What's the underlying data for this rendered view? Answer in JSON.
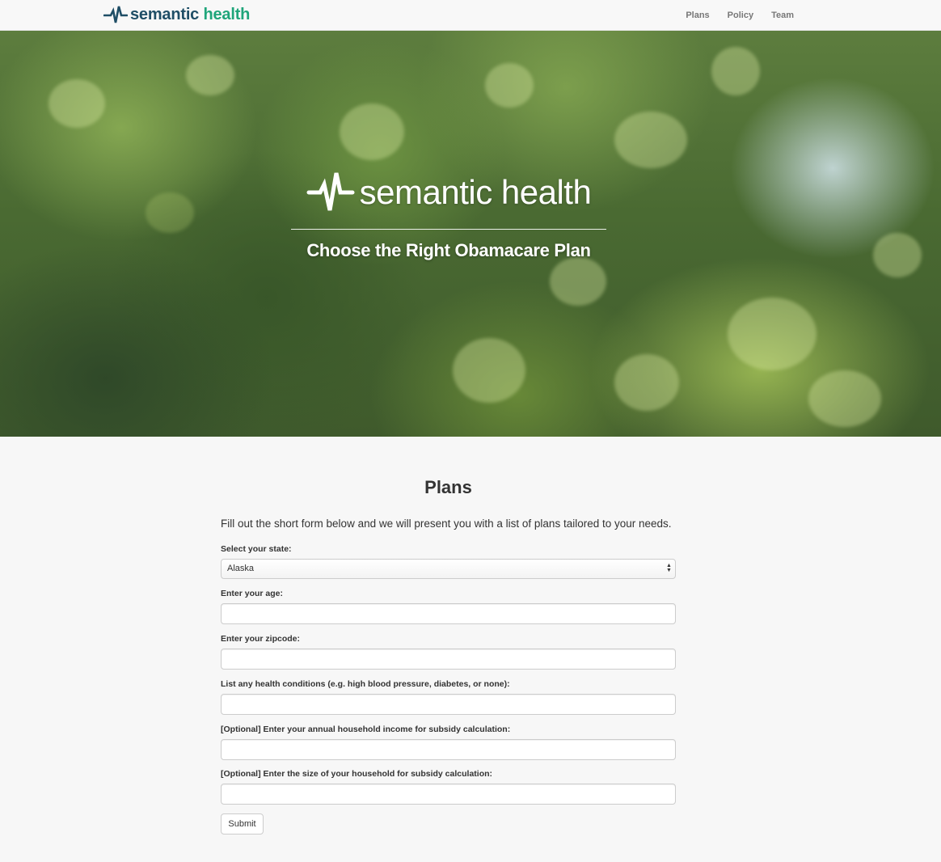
{
  "brand": {
    "name_part1": "semantic",
    "name_part2": "health",
    "color_dark": "#1f4e66",
    "color_green": "#1fa57a",
    "icon": "heartbeat-pulse-icon"
  },
  "nav": {
    "items": [
      {
        "label": "Plans"
      },
      {
        "label": "Policy"
      },
      {
        "label": "Team"
      }
    ]
  },
  "hero": {
    "logo_text": "semantic health",
    "tagline": "Choose the Right Obamacare Plan"
  },
  "plans": {
    "title": "Plans",
    "intro": "Fill out the short form below and we will present you with a list of plans tailored to your needs.",
    "state": {
      "label": "Select your state:",
      "value": "Alaska"
    },
    "age": {
      "label": "Enter your age:",
      "value": ""
    },
    "zipcode": {
      "label": "Enter your zipcode:",
      "value": ""
    },
    "conditions": {
      "label": "List any health conditions (e.g. high blood pressure, diabetes, or none):",
      "value": ""
    },
    "income": {
      "label": "[Optional] Enter your annual household income for subsidy calculation:",
      "value": ""
    },
    "household": {
      "label": "[Optional] Enter the size of your household for subsidy calculation:",
      "value": ""
    },
    "submit_label": "Submit"
  }
}
